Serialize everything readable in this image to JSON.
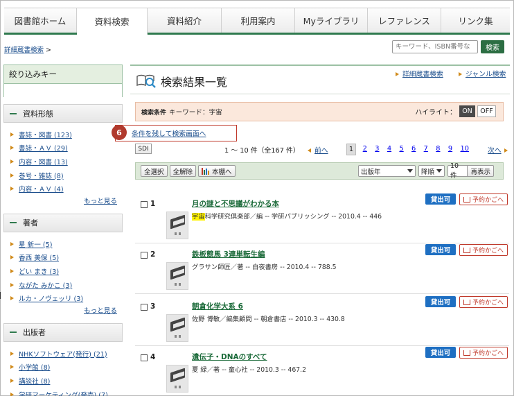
{
  "global_nav": {
    "tabs": [
      {
        "label": "図書館ホーム",
        "active": false
      },
      {
        "label": "資料検索",
        "active": true
      },
      {
        "label": "資料紹介",
        "active": false
      },
      {
        "label": "利用案内",
        "active": false
      },
      {
        "label": "Myライブラリ",
        "active": false
      },
      {
        "label": "レファレンス",
        "active": false
      },
      {
        "label": "リンク集",
        "active": false
      }
    ]
  },
  "breadcrumb": {
    "link": "詳細蔵書検索",
    "sep": ">"
  },
  "quick_search": {
    "placeholder": "キーワード、ISBN番号な",
    "button": "検索"
  },
  "sidebar": {
    "title": "絞り込みキー",
    "groups": [
      {
        "title": "資料形態",
        "items": [
          "書誌・図書 (123)",
          "書誌・ＡＶ (29)",
          "内容・図書 (13)",
          "巻号・雑誌 (8)",
          "内容・ＡＶ (4)"
        ],
        "more": "もっと見る"
      },
      {
        "title": "著者",
        "items": [
          "星 新一 (5)",
          "香西 美保 (5)",
          "どい まき (3)",
          "ながた みかこ (3)",
          "ルカ・ノヴェッリ (3)"
        ],
        "more": "もっと見る"
      },
      {
        "title": "出版者",
        "items": [
          "NHKソフトウェア(発行) (21)",
          "小学館 (8)",
          "講談社 (8)",
          "学研マーケティング(発売) (7)"
        ]
      }
    ]
  },
  "main": {
    "title": "検索結果一覧",
    "links": [
      "詳細蔵書検索",
      "ジャンル検索"
    ],
    "condition": {
      "label": "検索条件",
      "text": "キーワード：宇宙",
      "highlight_label": "ハイライト：",
      "on": "ON",
      "off": "OFF"
    },
    "back_link": {
      "badge": "6",
      "text": "条件を残して検索画面へ"
    },
    "sdi": "SDI",
    "count": "1 ～ 10 件（全167 件）",
    "prev": "前へ",
    "next": "次へ",
    "pages": [
      "1",
      "2",
      "3",
      "4",
      "5",
      "6",
      "7",
      "8",
      "9",
      "10"
    ],
    "current_page": "1",
    "toolbar": {
      "select_all": "全選択",
      "deselect_all": "全解除",
      "shelf": "本棚へ",
      "sort_key": "出版年",
      "sort_order": "降順",
      "per_page": "10件",
      "reshow": "再表示"
    },
    "results": [
      {
        "num": "1",
        "title": "月の謎と不思議がわかる本",
        "meta_mark": "宇宙",
        "meta": "科学研究倶楽部／編 -- 学研パブリッシング -- 2010.4 -- 446",
        "status": "貸出可",
        "cart": "予約かごへ"
      },
      {
        "num": "2",
        "title": "鉄板競馬 3連単転生編",
        "meta_mark": "",
        "meta": "グラサン師匠／著 -- 白夜書房 -- 2010.4 -- 788.5",
        "status": "貸出可",
        "cart": "予約かごへ"
      },
      {
        "num": "3",
        "title": "朝倉化学大系 6",
        "meta_mark": "",
        "meta": "佐野 博敏／編集顧問 -- 朝倉書店 -- 2010.3 -- 430.8",
        "status": "貸出可",
        "cart": "予約かごへ"
      },
      {
        "num": "4",
        "title": "遺伝子・DNAのすべて",
        "meta_mark": "",
        "meta": "夏 緑／著 -- 童心社 -- 2010.3 -- 467.2",
        "status": "貸出可",
        "cart": "予約かごへ"
      }
    ]
  },
  "colors": {
    "accent_green": "#2f7a4e",
    "link_blue": "#1a4d8c",
    "title_green": "#1c6b3a",
    "available_blue": "#1e6fc2",
    "cart_red": "#c0392b",
    "condition_bg": "#fbe8dc"
  }
}
